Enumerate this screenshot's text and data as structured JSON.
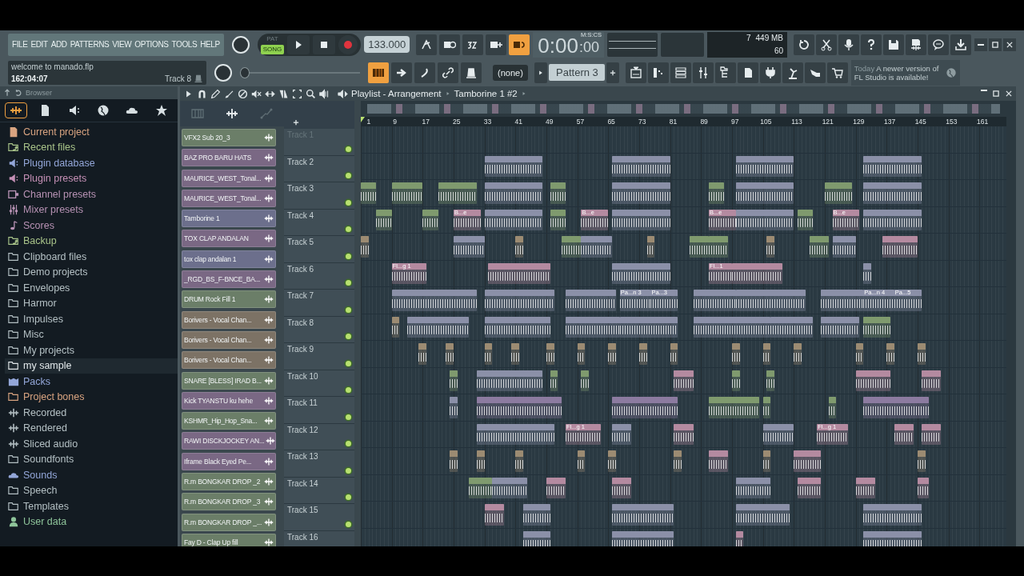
{
  "menu": [
    "FILE",
    "EDIT",
    "ADD",
    "PATTERNS",
    "VIEW",
    "OPTIONS",
    "TOOLS",
    "HELP"
  ],
  "transport": {
    "modes": [
      {
        "label": "PAT",
        "selected": false
      },
      {
        "label": "SONG",
        "selected": true
      }
    ],
    "tempo": "133.000"
  },
  "toolbar_top": [
    {
      "on": false
    },
    {
      "on": false
    },
    {
      "on": false
    },
    {
      "on": false
    },
    {
      "on": true
    }
  ],
  "time": {
    "main": "0:00",
    "cs": ":00",
    "format": "M:S:CS"
  },
  "monitor": {
    "cpu": "7",
    "memory": "449 MB",
    "polyphony": "60"
  },
  "hint": {
    "line1": "welcome to manado.flp",
    "line2": "162:04:07",
    "target": "Track 8"
  },
  "master_pitch": {
    "level": 0.0
  },
  "toolbar_mid": [
    {
      "on": true
    },
    {
      "on": false
    },
    {
      "on": false
    },
    {
      "on": false
    },
    {
      "on": false
    }
  ],
  "pattern_dropdown": "(none)",
  "pattern": "Pattern 3",
  "news": {
    "when": "Today",
    "message": "A newer version of FL Studio is available!"
  },
  "browser": {
    "title": "Browser",
    "tabs": [
      {
        "selected": true
      },
      {
        "selected": false
      },
      {
        "selected": false
      },
      {
        "selected": false
      },
      {
        "selected": false
      },
      {
        "selected": false
      }
    ],
    "items": [
      {
        "label": "Current project",
        "kind": "document",
        "color": "#d9a480",
        "selected": false
      },
      {
        "label": "Recent files",
        "kind": "recent",
        "color": "#a9c48a",
        "selected": false
      },
      {
        "label": "Plugin database",
        "kind": "plugin",
        "color": "#93a6d8",
        "selected": false
      },
      {
        "label": "Plugin presets",
        "kind": "plugin",
        "color": "#c590b6",
        "selected": false
      },
      {
        "label": "Channel presets",
        "kind": "channel",
        "color": "#b792b4",
        "selected": false
      },
      {
        "label": "Mixer presets",
        "kind": "mixer",
        "color": "#b792b4",
        "selected": false
      },
      {
        "label": "Scores",
        "kind": "note",
        "color": "#b792b4",
        "selected": false
      },
      {
        "label": "Backup",
        "kind": "recent",
        "color": "#a9c48a",
        "selected": false
      },
      {
        "label": "Clipboard files",
        "kind": "folder",
        "color": "#b4c0c4",
        "selected": false
      },
      {
        "label": "Demo projects",
        "kind": "folder",
        "color": "#b4c0c4",
        "selected": false
      },
      {
        "label": "Envelopes",
        "kind": "folder",
        "color": "#b4c0c4",
        "selected": false
      },
      {
        "label": "Harmor",
        "kind": "folder",
        "color": "#b4c0c4",
        "selected": false
      },
      {
        "label": "Impulses",
        "kind": "folder",
        "color": "#b4c0c4",
        "selected": false
      },
      {
        "label": "Misc",
        "kind": "folder",
        "color": "#b4c0c4",
        "selected": false
      },
      {
        "label": "My projects",
        "kind": "folder",
        "color": "#b4c0c4",
        "selected": false
      },
      {
        "label": "my sample",
        "kind": "folder",
        "color": "#e2e8ea",
        "selected": true
      },
      {
        "label": "Packs",
        "kind": "packs",
        "color": "#93a6d8",
        "selected": false
      },
      {
        "label": "Project bones",
        "kind": "folder",
        "color": "#d9a480",
        "selected": false
      },
      {
        "label": "Recorded",
        "kind": "wave",
        "color": "#b4c0c4",
        "selected": false
      },
      {
        "label": "Rendered",
        "kind": "wave",
        "color": "#b4c0c4",
        "selected": false
      },
      {
        "label": "Sliced audio",
        "kind": "wave",
        "color": "#b4c0c4",
        "selected": false
      },
      {
        "label": "Soundfonts",
        "kind": "folder",
        "color": "#b4c0c4",
        "selected": false
      },
      {
        "label": "Sounds",
        "kind": "cloud",
        "color": "#93a6d8",
        "selected": false
      },
      {
        "label": "Speech",
        "kind": "folder",
        "color": "#b4c0c4",
        "selected": false
      },
      {
        "label": "Templates",
        "kind": "folder",
        "color": "#b4c0c4",
        "selected": false
      },
      {
        "label": "User data",
        "kind": "user",
        "color": "#8ec49a",
        "selected": false
      }
    ]
  },
  "playlist": {
    "title": "Playlist - Arrangement",
    "pattern": "Tamborine 1 #2",
    "picker_tabs": [
      {
        "selected": false
      },
      {
        "selected": true
      },
      {
        "selected": false
      }
    ],
    "picker": [
      {
        "name": "VFX2 Sub 20_3",
        "color": "#6b7e68"
      },
      {
        "name": "BAZ PRO BARU HATS",
        "color": "#7a6884"
      },
      {
        "name": "MAURICE_WEST_Tonal...",
        "color": "#7a6884"
      },
      {
        "name": "MAURICE_WEST_Tonal...",
        "color": "#7a6884"
      },
      {
        "name": "Tamborine 1",
        "color": "#6c6f8c"
      },
      {
        "name": "TOX CLAP ANDALAN",
        "color": "#7a6884"
      },
      {
        "name": "tox clap andalan 1",
        "color": "#6c6f8c"
      },
      {
        "name": "_RGD_BS_F-BNCE_BA...",
        "color": "#7a6884"
      },
      {
        "name": "DRUM Rock Fill 1",
        "color": "#6b7e68"
      },
      {
        "name": "Borivers - Vocal Chan...",
        "color": "#7c7265"
      },
      {
        "name": "Borivers - Vocal Chan...",
        "color": "#7c7265"
      },
      {
        "name": "Borivers - Vocal Chan...",
        "color": "#7c7265"
      },
      {
        "name": "SNARE [BLESS] IRAD B...",
        "color": "#6b7e68"
      },
      {
        "name": "Kick TYANSTU ku hehe",
        "color": "#7a6884"
      },
      {
        "name": "KSHMR_Hip_Hop_Sna...",
        "color": "#6b7e68"
      },
      {
        "name": "RAWI DISCKJOCKEY AN...",
        "color": "#7a6884"
      },
      {
        "name": "Iframe Black Eyed Pe...",
        "color": "#7a6884"
      },
      {
        "name": "R.m BONGKAR DROP _2",
        "color": "#6b7e68"
      },
      {
        "name": "R.m BONGKAR DROP _3",
        "color": "#6b7e68"
      },
      {
        "name": "R.m BONGKAR DROP _...",
        "color": "#6b7e68"
      },
      {
        "name": "Fay D - Clap Up fill",
        "color": "#6b7e68"
      }
    ],
    "ruler": [
      "1",
      "9",
      "17",
      "25",
      "33",
      "41",
      "49",
      "57",
      "65",
      "73",
      "81",
      "89",
      "97",
      "105",
      "113",
      "121",
      "129",
      "137",
      "145",
      "153",
      "161"
    ],
    "tracks": [
      {
        "name": "Track 1"
      },
      {
        "name": "Track 2",
        "clips": [
          {
            "color": "#8b90a8"
          },
          {
            "color": "#8b90a8"
          },
          {
            "color": "#8b90a8"
          },
          {
            "color": "#8b90a8"
          }
        ]
      },
      {
        "name": "Track 3",
        "clips": [
          {
            "color": "#7f9a6e"
          },
          {
            "color": "#7f9a6e"
          },
          {
            "color": "#7f9a6e"
          },
          {
            "color": "#8b90a8"
          },
          {
            "color": "#7f9a6e"
          },
          {
            "color": "#8b90a8"
          },
          {
            "color": "#7f9a6e"
          },
          {
            "color": "#8b90a8"
          },
          {
            "color": "#7f9a6e"
          },
          {
            "color": "#8b90a8"
          }
        ]
      },
      {
        "name": "Track 4",
        "clips": [
          {
            "color": "#7f9a6e"
          },
          {
            "color": "#7f9a6e"
          },
          {
            "color": "#b48aa0",
            "label": "B...e"
          },
          {
            "color": "#8b90a8"
          },
          {
            "color": "#7f9a6e"
          },
          {
            "color": "#b48aa0",
            "label": "B...e"
          },
          {
            "color": "#8b90a8"
          },
          {
            "color": "#b48aa0",
            "label": "B...e"
          },
          {
            "color": "#8b90a8"
          },
          {
            "color": "#7f9a6e"
          },
          {
            "color": "#b48aa0",
            "label": "B...e"
          },
          {
            "color": "#8b90a8"
          }
        ]
      },
      {
        "name": "Track 5",
        "clips": [
          {
            "color": "#9c8b72"
          },
          {
            "color": "#8b90a8"
          },
          {
            "color": "#9c8b72"
          },
          {
            "color": "#7f9a6e"
          },
          {
            "color": "#8b90a8"
          },
          {
            "color": "#9c8b72"
          },
          {
            "color": "#7f9a6e"
          },
          {
            "color": "#7f9a6e"
          },
          {
            "color": "#9c8b72"
          },
          {
            "color": "#7f9a6e"
          },
          {
            "color": "#8b90a8"
          },
          {
            "color": "#b48aa0"
          }
        ]
      },
      {
        "name": "Track 6",
        "clips": [
          {
            "color": "#b48aa0",
            "label": "Fl...g 1"
          },
          {
            "color": "#b48aa0"
          },
          {
            "color": "#8b90a8"
          },
          {
            "color": "#b48aa0",
            "label": "Fl...1"
          },
          {
            "color": "#b48aa0"
          },
          {
            "color": "#8b90a8"
          }
        ]
      },
      {
        "name": "Track 7",
        "clips": [
          {
            "color": "#8b90a8"
          },
          {
            "color": "#8b90a8"
          },
          {
            "color": "#8b90a8"
          },
          {
            "color": "#8b90a8",
            "label": "Pa...n 3"
          },
          {
            "color": "#8b90a8",
            "label": "Pa...3"
          },
          {
            "color": "#8b90a8"
          },
          {
            "color": "#8b90a8"
          },
          {
            "color": "#8b90a8"
          },
          {
            "color": "#8b90a8",
            "label": "Pa...n 4"
          },
          {
            "color": "#8b90a8",
            "label": "Pa...5"
          }
        ]
      },
      {
        "name": "Track 8",
        "clips": [
          {
            "color": "#9c8b72"
          },
          {
            "color": "#8b90a8"
          },
          {
            "color": "#8b90a8"
          },
          {
            "color": "#8b90a8"
          },
          {
            "color": "#8b90a8"
          },
          {
            "color": "#8b90a8"
          },
          {
            "color": "#8b90a8"
          },
          {
            "color": "#8b90a8"
          },
          {
            "color": "#7f9a6e"
          }
        ]
      },
      {
        "name": "Track 9",
        "clips": [
          {
            "color": "#9c8b72"
          },
          {
            "color": "#9c8b72"
          },
          {
            "color": "#9c8b72"
          },
          {
            "color": "#9c8b72"
          },
          {
            "color": "#9c8b72"
          },
          {
            "color": "#9c8b72"
          },
          {
            "color": "#9c8b72"
          },
          {
            "color": "#9c8b72"
          },
          {
            "color": "#9c8b72"
          },
          {
            "color": "#9c8b72"
          },
          {
            "color": "#9c8b72"
          },
          {
            "color": "#9c8b72"
          },
          {
            "color": "#9c8b72"
          },
          {
            "color": "#9c8b72"
          },
          {
            "color": "#9c8b72"
          }
        ]
      },
      {
        "name": "Track 10",
        "clips": [
          {
            "color": "#7f9a6e"
          },
          {
            "color": "#8b90a8"
          },
          {
            "color": "#7f9a6e"
          },
          {
            "color": "#7f9a6e"
          },
          {
            "color": "#b48aa0"
          },
          {
            "color": "#7f9a6e"
          },
          {
            "color": "#7f9a6e"
          },
          {
            "color": "#b48aa0"
          },
          {
            "color": "#b48aa0"
          }
        ]
      },
      {
        "name": "Track 11",
        "clips": [
          {
            "color": "#8b90a8"
          },
          {
            "color": "#8c7ba0"
          },
          {
            "color": "#8c7ba0"
          },
          {
            "color": "#7f9a6e"
          },
          {
            "color": "#7f9a6e"
          },
          {
            "color": "#7f9a6e"
          },
          {
            "color": "#8c7ba0"
          }
        ]
      },
      {
        "name": "Track 12",
        "clips": [
          {
            "color": "#8b90a8"
          },
          {
            "color": "#b48aa0",
            "label": "Fl...g 1"
          },
          {
            "color": "#8b90a8"
          },
          {
            "color": "#b48aa0"
          },
          {
            "color": "#8b90a8"
          },
          {
            "color": "#b48aa0",
            "label": "Fl...g 1"
          },
          {
            "color": "#b48aa0"
          },
          {
            "color": "#b48aa0"
          }
        ]
      },
      {
        "name": "Track 13",
        "clips": [
          {
            "color": "#9c8b72"
          },
          {
            "color": "#9c8b72"
          },
          {
            "color": "#9c8b72"
          },
          {
            "color": "#9c8b72"
          },
          {
            "color": "#9c8b72"
          },
          {
            "color": "#9c8b72"
          },
          {
            "color": "#b48aa0"
          },
          {
            "color": "#9c8b72"
          },
          {
            "color": "#b48aa0"
          },
          {
            "color": "#9c8b72"
          }
        ]
      },
      {
        "name": "Track 14",
        "clips": [
          {
            "color": "#7f9a6e"
          },
          {
            "color": "#8b90a8"
          },
          {
            "color": "#b48aa0"
          },
          {
            "color": "#b48aa0"
          },
          {
            "color": "#8b90a8"
          },
          {
            "color": "#b48aa0"
          },
          {
            "color": "#b48aa0"
          },
          {
            "color": "#b48aa0"
          }
        ]
      },
      {
        "name": "Track 15",
        "clips": [
          {
            "color": "#b48aa0"
          },
          {
            "color": "#8b90a8"
          },
          {
            "color": "#8b90a8"
          },
          {
            "color": "#8b90a8"
          },
          {
            "color": "#8b90a8"
          }
        ]
      },
      {
        "name": "Track 16",
        "clips": [
          {
            "color": "#8b90a8"
          },
          {
            "color": "#8b90a8"
          },
          {
            "color": "#b48aa0"
          },
          {
            "color": "#8b90a8"
          }
        ]
      }
    ]
  }
}
